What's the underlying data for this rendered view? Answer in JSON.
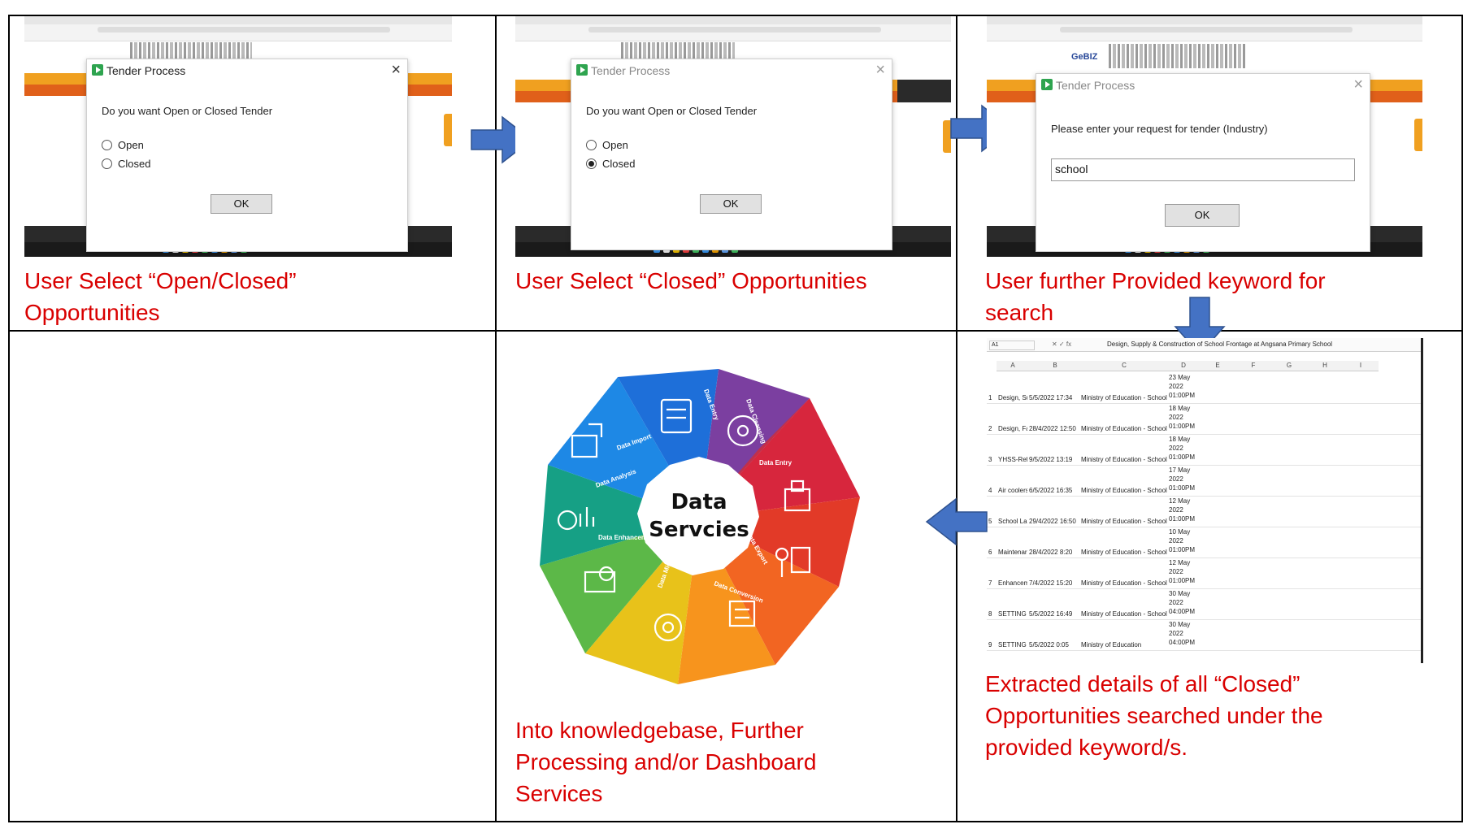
{
  "panels": {
    "p1": {
      "dialog_title": "Tender Process",
      "question": "Do you want Open or Closed Tender",
      "options": [
        "Open",
        "Closed"
      ],
      "selected": null,
      "ok": "OK",
      "caption": "User Select “Open/Closed”\nOpportunities"
    },
    "p2": {
      "dialog_title": "Tender Process",
      "question": "Do you want Open or Closed Tender",
      "options": [
        "Open",
        "Closed"
      ],
      "selected": "Closed",
      "ok": "OK",
      "caption": "User Select “Closed” Opportunities"
    },
    "p3": {
      "dialog_title": "Tender Process",
      "question": "Please enter your request for tender (Industry)",
      "input_value": "school",
      "ok": "OK",
      "logo_text": "GeBIZ",
      "caption": "User further Provided keyword for\nsearch"
    },
    "p4": {
      "caption": "Extracted details of all “Closed”\nOpportunities searched under the\nprovided keyword/s."
    },
    "p5": {
      "caption": "Into knowledgebase, Further\nProcessing and/or Dashboard\nServices"
    }
  },
  "spreadsheet": {
    "cell_ref": "A1",
    "formula": "Design, Supply & Construction of School Frontage at Angsana Primary School",
    "columns": [
      "A",
      "B",
      "C",
      "D",
      "E",
      "F",
      "G",
      "H",
      "I"
    ],
    "rows": [
      {
        "n": "1",
        "a": "Design, Su",
        "b": "5/5/2022 17:34",
        "c": "Ministry of Education - Schools",
        "d": "23 May\n2022\n01:00PM"
      },
      {
        "n": "2",
        "a": "Design, Fal",
        "b": "28/4/2022 12:50",
        "c": "Ministry of Education - Schools",
        "d": "18 May\n2022\n01:00PM"
      },
      {
        "n": "3",
        "a": "YHSS-Refu",
        "b": "9/5/2022 13:19",
        "c": "Ministry of Education - Schools",
        "d": "18 May\n2022\n01:00PM"
      },
      {
        "n": "4",
        "a": "Air coolers",
        "b": "6/5/2022 16:35",
        "c": "Ministry of Education - Schools",
        "d": "17 May\n2022\n01:00PM"
      },
      {
        "n": "5",
        "a": "School Lar",
        "b": "29/4/2022 16:50",
        "c": "Ministry of Education - Schools",
        "d": "12 May\n2022\n01:00PM"
      },
      {
        "n": "6",
        "a": "Maintenar",
        "b": "28/4/2022 8:20",
        "c": "Ministry of Education - Schools",
        "d": "10 May\n2022\n01:00PM"
      },
      {
        "n": "7",
        "a": "Enhancem",
        "b": "7/4/2022 15:20",
        "c": "Ministry of Education - Schools",
        "d": "12 May\n2022\n01:00PM"
      },
      {
        "n": "8",
        "a": "SETTING L",
        "b": "5/5/2022 16:49",
        "c": "Ministry of Education - Schools",
        "d": "30 May\n2022\n04:00PM"
      },
      {
        "n": "9",
        "a": "SETTING L",
        "b": "5/5/2022 0:05",
        "c": "Ministry of Education",
        "d": "30 May\n2022\n04:00PM"
      }
    ]
  },
  "wheel": {
    "title_line1": "Data",
    "title_line2": "Servcies",
    "segments": [
      {
        "label": "Data Entry",
        "color": "#7b3fa0"
      },
      {
        "label": "Data Cleansing",
        "color": "#c0304a"
      },
      {
        "label": "Data Entry",
        "color": "#e23a28"
      },
      {
        "label": "Data Export",
        "color": "#f26522"
      },
      {
        "label": "Data Conversion",
        "color": "#f7941d"
      },
      {
        "label": "Data Migration",
        "color": "#e8c21a"
      },
      {
        "label": "Data Enhancement",
        "color": "#5cb848"
      },
      {
        "label": "Data Analysis",
        "color": "#16a085"
      },
      {
        "label": "Data Import",
        "color": "#1e88e5"
      }
    ]
  },
  "colors": {
    "caption": "#d90000",
    "arrow": "#4472c4",
    "arrow_stroke": "#2f528f"
  }
}
